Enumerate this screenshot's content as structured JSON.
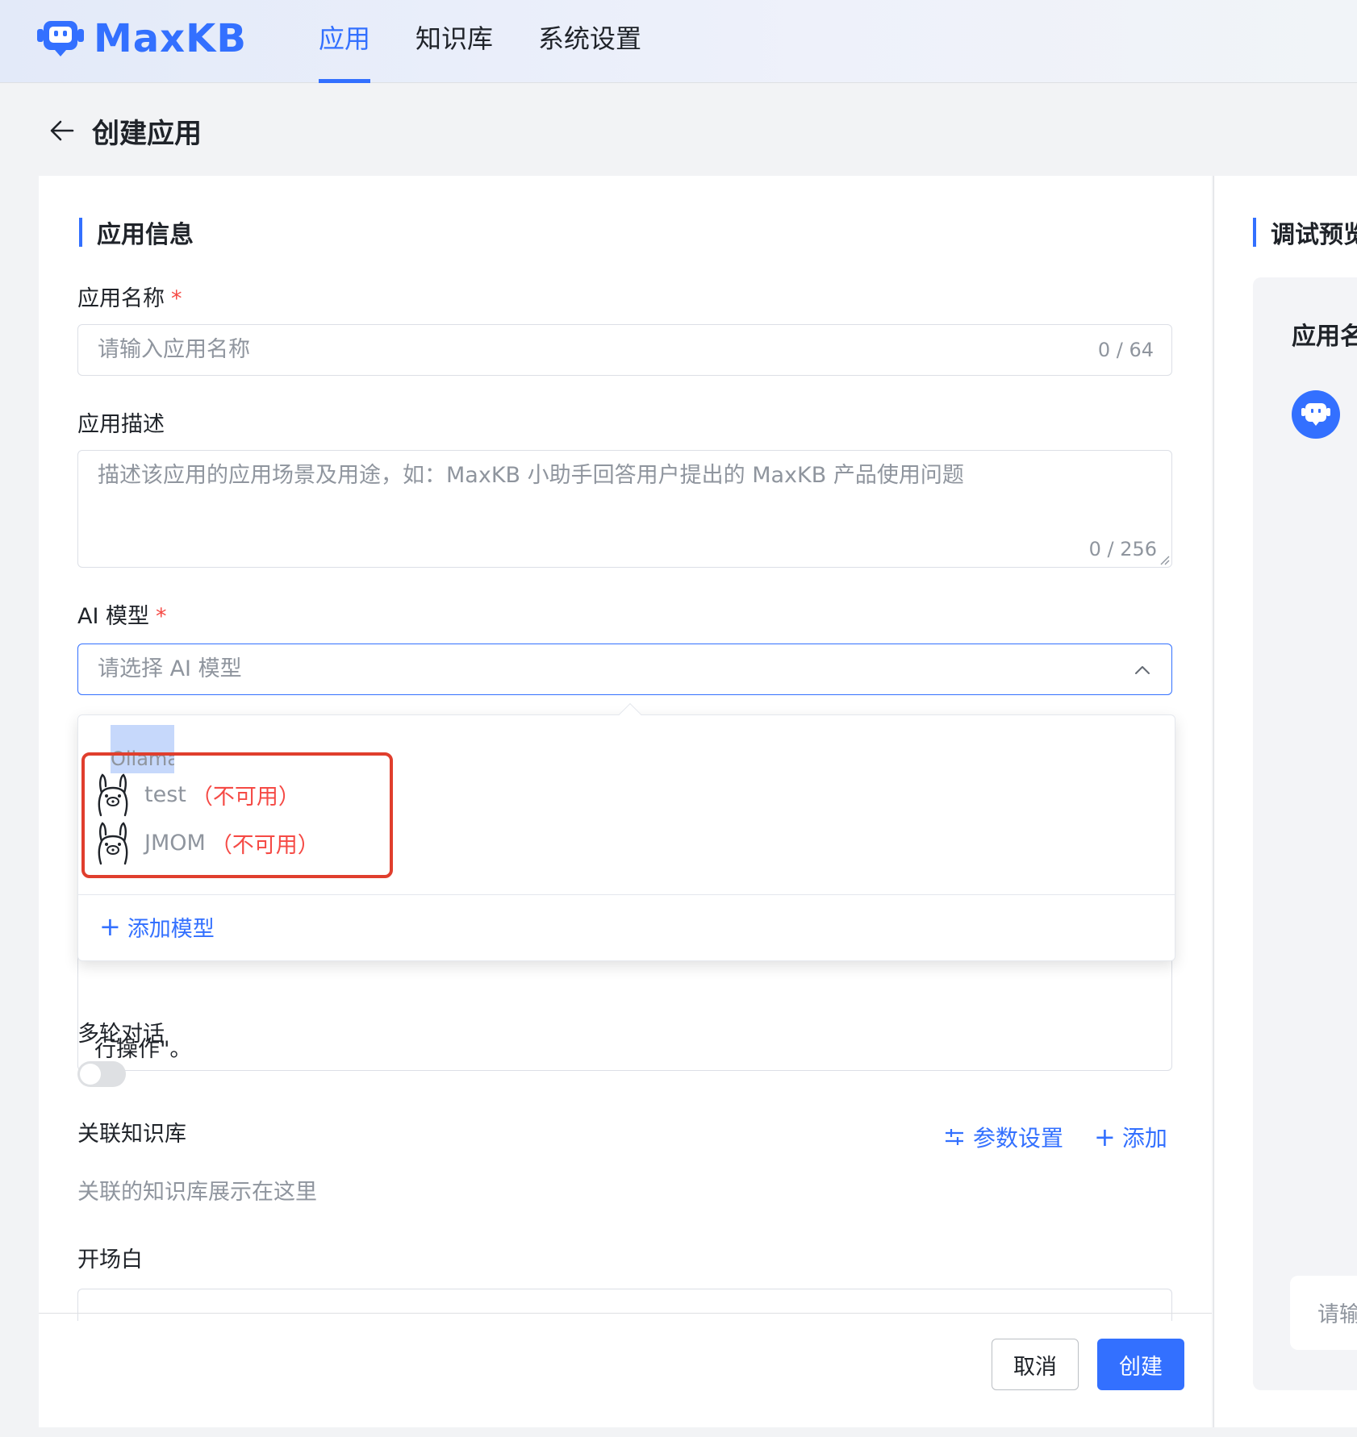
{
  "brand": {
    "name": "MaxKB",
    "color": "#3370ff"
  },
  "nav": {
    "items": [
      "应用",
      "知识库",
      "系统设置"
    ],
    "active": "应用"
  },
  "page": {
    "title": "创建应用"
  },
  "form": {
    "section_title": "应用信息",
    "name": {
      "label": "应用名称",
      "required": "*",
      "placeholder": "请输入应用名称",
      "counter": "0 / 64"
    },
    "description": {
      "label": "应用描述",
      "placeholder": "描述该应用的应用场景及用途，如：MaxKB 小助手回答用户提出的 MaxKB 产品使用问题",
      "counter": "0 / 256"
    },
    "ai_model": {
      "label": "AI 模型",
      "required": "*",
      "placeholder": "请选择 AI 模型"
    },
    "prompt_partial_text": "行操作\"。",
    "multi_turn": {
      "label": "多轮对话",
      "enabled": false
    },
    "knowledge": {
      "label": "关联知识库",
      "params_label": "参数设置",
      "add_label": "添加",
      "empty_hint": "关联的知识库展示在这里"
    },
    "opening": {
      "label": "开场白"
    },
    "buttons": {
      "cancel": "取消",
      "create": "创建"
    }
  },
  "dropdown": {
    "group": "Ollama",
    "options": [
      {
        "name": "test",
        "status": "（不可用）",
        "icon": "llama-icon"
      },
      {
        "name": "JMOM",
        "status": "（不可用）",
        "icon": "llama-icon"
      }
    ],
    "add_model": "添加模型"
  },
  "preview": {
    "title": "调试预览",
    "app_name_label": "应用名称",
    "input_placeholder": "请输入"
  },
  "colors": {
    "accent": "#3370ff",
    "danger": "#f54a45",
    "highlight_box": "#e03e2d"
  }
}
